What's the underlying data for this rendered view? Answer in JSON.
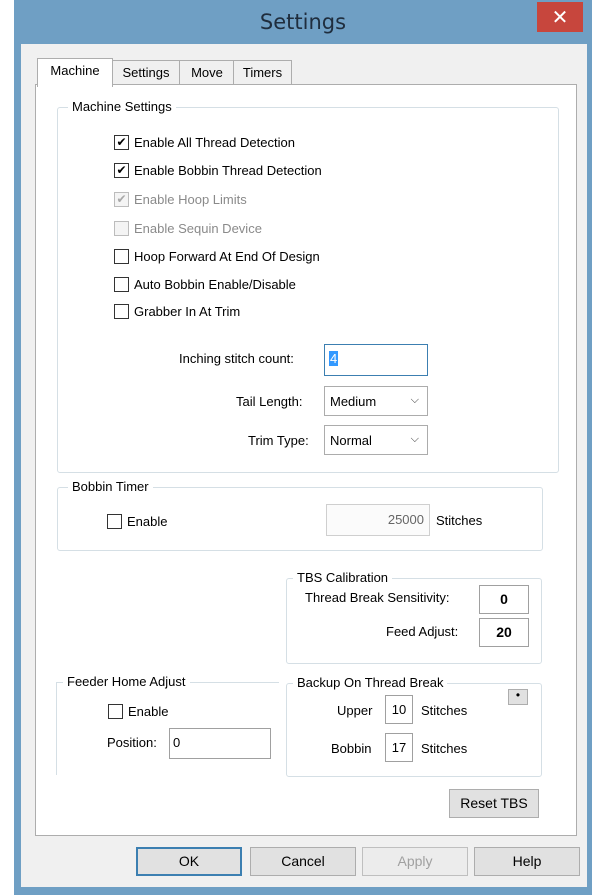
{
  "window": {
    "title": "Settings",
    "close_icon": "close-icon"
  },
  "tabs": [
    {
      "label": "Machine",
      "active": true
    },
    {
      "label": "Settings",
      "active": false
    },
    {
      "label": "Move",
      "active": false
    },
    {
      "label": "Timers",
      "active": false
    }
  ],
  "machine_settings": {
    "legend": "Machine Settings",
    "checkboxes": [
      {
        "label": "Enable All Thread Detection",
        "checked": true,
        "enabled": true
      },
      {
        "label": "Enable Bobbin Thread Detection",
        "checked": true,
        "enabled": true
      },
      {
        "label": "Enable Hoop Limits",
        "checked": true,
        "enabled": false
      },
      {
        "label": "Enable Sequin Device",
        "checked": false,
        "enabled": false
      },
      {
        "label": "Hoop Forward At End Of Design",
        "checked": false,
        "enabled": true
      },
      {
        "label": "Auto Bobbin Enable/Disable",
        "checked": false,
        "enabled": true
      },
      {
        "label": "Grabber In At Trim",
        "checked": false,
        "enabled": true
      }
    ],
    "inching_label": "Inching stitch count:",
    "inching_value": "4",
    "tail_label": "Tail Length:",
    "tail_value": "Medium",
    "trim_label": "Trim Type:",
    "trim_value": "Normal"
  },
  "bobbin_timer": {
    "legend": "Bobbin Timer",
    "enable_label": "Enable",
    "stitches_value": "25000",
    "stitches_label": "Stitches"
  },
  "tbs_calibration": {
    "legend": "TBS Calibration",
    "sensitivity_label": "Thread Break Sensitivity:",
    "sensitivity_value": "0",
    "feed_label": "Feed Adjust:",
    "feed_value": "20"
  },
  "feeder_home": {
    "legend": "Feeder Home Adjust",
    "enable_label": "Enable",
    "position_label": "Position:",
    "position_value": "0"
  },
  "backup_thread_break": {
    "legend": "Backup On Thread Break",
    "dot_button": "•",
    "upper_label": "Upper",
    "upper_value": "10",
    "bobbin_label": "Bobbin",
    "bobbin_value": "17",
    "stitches_label": "Stitches"
  },
  "reset_tbs_label": "Reset TBS",
  "buttons": {
    "ok": "OK",
    "cancel": "Cancel",
    "apply": "Apply",
    "help": "Help"
  },
  "colors": {
    "title_bar": "#6f9fc4",
    "close_button": "#c7463d",
    "focus_border": "#3c7fb1"
  }
}
